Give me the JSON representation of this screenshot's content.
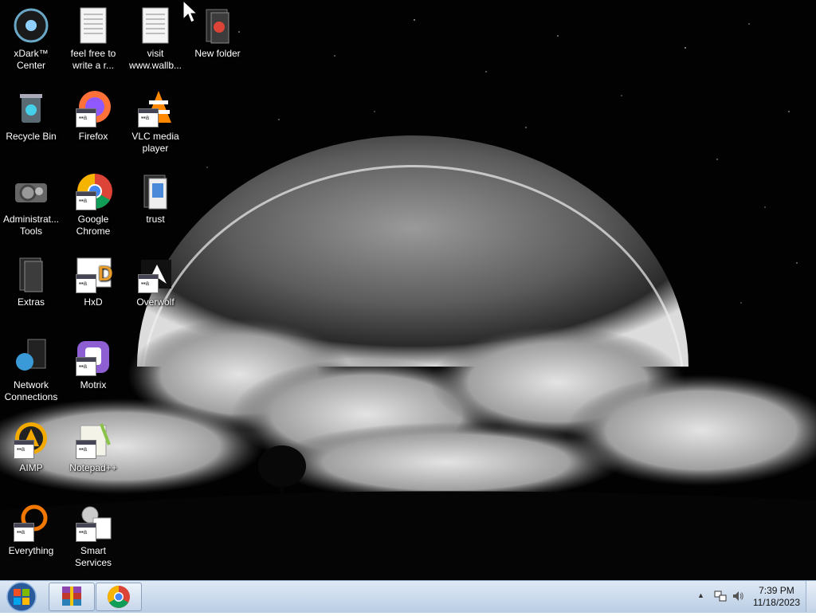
{
  "desktop": {
    "icons": [
      {
        "label": "xDark™ Center",
        "icon": "xdark-icon"
      },
      {
        "label": "feel free to write a r...",
        "icon": "text-file-icon"
      },
      {
        "label": "visit www.wallb...",
        "icon": "text-file-icon"
      },
      {
        "label": "New folder",
        "icon": "folder-icon"
      },
      {
        "label": "Recycle Bin",
        "icon": "recycle-bin-icon"
      },
      {
        "label": "Firefox",
        "icon": "firefox-icon"
      },
      {
        "label": "VLC media player",
        "icon": "vlc-icon"
      },
      {
        "label": "Administrat... Tools",
        "icon": "admin-tools-icon"
      },
      {
        "label": "Google Chrome",
        "icon": "chrome-icon"
      },
      {
        "label": "trust",
        "icon": "folder-icon"
      },
      {
        "label": "Extras",
        "icon": "folder-icon"
      },
      {
        "label": "HxD",
        "icon": "hxd-icon"
      },
      {
        "label": "Overwolf",
        "icon": "overwolf-icon"
      },
      {
        "label": "Network Connections",
        "icon": "network-icon"
      },
      {
        "label": "Motrix",
        "icon": "motrix-icon"
      },
      {
        "label": "AIMP",
        "icon": "aimp-icon"
      },
      {
        "label": "Notepad++",
        "icon": "notepadpp-icon"
      },
      {
        "label": "Everything",
        "icon": "everything-icon"
      },
      {
        "label": "Smart Services",
        "icon": "smart-services-icon"
      }
    ]
  },
  "taskbar": {
    "start_icon": "windows-orb-icon",
    "pinned": [
      {
        "icon": "winrar-icon"
      },
      {
        "icon": "chrome-icon"
      }
    ],
    "tray": {
      "chevron": "▲",
      "time": "7:39 PM",
      "date": "11/18/2023"
    }
  },
  "colors": {
    "taskbar_top": "#dfe9f5",
    "taskbar_bottom": "#b9cde4",
    "desktop_bg": "#000000"
  }
}
